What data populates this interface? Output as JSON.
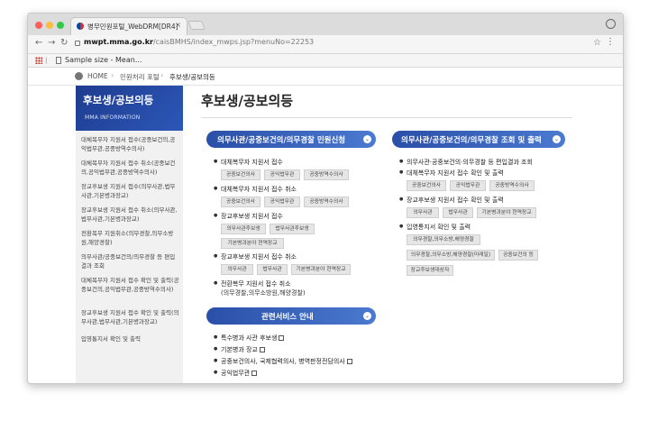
{
  "browser": {
    "tab_title": "병무민원포털_WebDRM[DR4]",
    "tab_close": "×",
    "url_host": "mwpt.mma.go.kr",
    "url_path": "/caisBMHS/index_mwps.jsp?menuNo=22253",
    "bookmark_label": "Sample size - Mean..."
  },
  "breadcrumb": [
    "HOME",
    "민원처리 포털",
    "후보생/공보의등"
  ],
  "sidebar": {
    "title": "후보생/공보의등",
    "subtitle": "MMA INFORMATION",
    "items": [
      "대체복무자 지원서 접수(공중보건의,공익법무관,공중방역수의사)",
      "대체복무자 지원서 접수 취소(공중보건의,공익법무관,공중방역수의사)",
      "장교후보생 지원서 접수(의무사관,법무사관,기본병과장교)",
      "장교후보생 지원서 접수 취소(의무사관,법무사관,기본병과장교)",
      "전환복무 지원취소(의무경찰,의무소방원,해양경찰)",
      "의무사관/공중보건의/의무경찰 등 편입결과 조회",
      "대체복무자 지원서 접수 확인 및 출력(공중보건의,공익법무관,공중방역수의사)",
      "장교후보생 지원서 접수 확인 및 출력(의무사관,법무사관,기본병과장교)",
      "입영통지서 확인 및 출력"
    ]
  },
  "main": {
    "title": "후보생/공보의등",
    "left_section": {
      "header": "의무사관/공중보건의/의무경찰 민원신청",
      "groups": [
        {
          "label": "대체복무자 지원서 접수",
          "tags": [
            "공중보건의사",
            "공익법무관",
            "공중방역수의사"
          ]
        },
        {
          "label": "대체복무자 지원서 접수 취소",
          "tags": [
            "공중보건의사",
            "공익법무관",
            "공중방역수의사"
          ]
        },
        {
          "label": "장교후보생 지원서 접수",
          "tags": [
            "의무사관후보생",
            "법무사관후보생",
            "기본병과분야 현역장교"
          ]
        },
        {
          "label": "장교후보생 지원서 접수 취소",
          "tags": [
            "의무사관",
            "법무사관",
            "기본병과분야 현역장교"
          ]
        }
      ],
      "last_item": "전환복무 지원서 접수 취소",
      "last_item_sub": "(의무경찰,의무소방원,해양경찰)"
    },
    "service_section": {
      "header": "관련서비스 안내",
      "items": [
        "특수병과 사관 후보생",
        "기본병과 장교",
        "공중보건의사, 국제협력의사, 병역판정전담의사",
        "공익법무관"
      ]
    },
    "right_section": {
      "header": "의무사관/공중보건의/의무경찰 조회 및 출력",
      "items": [
        {
          "label": "의무사관·공중보건의·의무경찰 등 편입결과 조회",
          "tags": []
        },
        {
          "label": "대체복무자 지원서 접수 확인 및 출력",
          "tags": [
            "공중보건의사",
            "공익법무관",
            "공중방역수의사"
          ]
        },
        {
          "label": "장교후보생 지원서 접수 확인 및 출력",
          "tags": [
            "의무사관",
            "법무사관",
            "기본병과분야 현역장교"
          ]
        },
        {
          "label": "입영통지서 확인 및 출력",
          "tags": [
            "의무경찰,의무소방,해양경찰",
            "의무경찰,의무소방,해양경찰(미래일)",
            "공중보건의 등",
            "장교후보생대상자"
          ]
        }
      ]
    }
  }
}
